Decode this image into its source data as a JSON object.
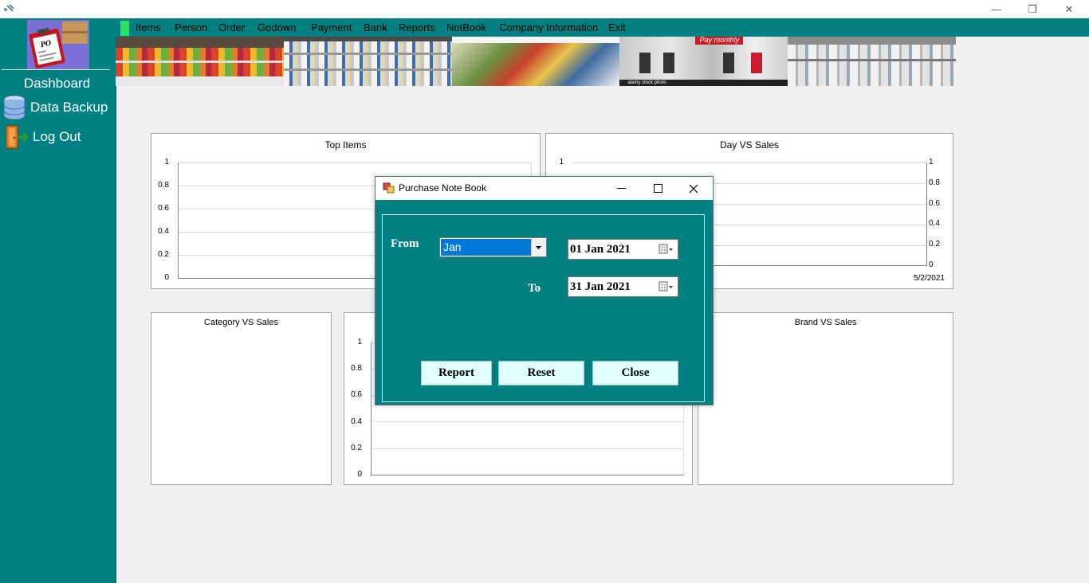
{
  "window": {
    "minimize_glyph": "—",
    "restore_glyph": "❐",
    "close_glyph": "✕"
  },
  "sidebar": {
    "logo_text": "PO",
    "dashboard_label": "Dashboard",
    "backup_label": "Data Backup",
    "logout_label": "Log Out"
  },
  "menu": {
    "items": [
      "Items",
      "Person",
      "Order",
      "Godown",
      "Payment",
      "Bank",
      "Reports",
      "NotBook",
      "Company Information",
      "Exit"
    ]
  },
  "banner": {
    "caption": "Pay monthly",
    "watermark": "alamy stock photo"
  },
  "panels": {
    "top_items": {
      "title": "Top Items"
    },
    "day_vs_sales": {
      "title": "Day VS Sales",
      "date_label": "5/2/2021"
    },
    "category_vs_sales": {
      "title": "Category VS Sales"
    },
    "brand_vs_sales": {
      "title": "Brand VS Sales"
    }
  },
  "chart_data": [
    {
      "type": "bar",
      "title": "Top Items",
      "categories": [],
      "values": [],
      "ylim": [
        0,
        1
      ],
      "yticks": [
        "1",
        "0.8",
        "0.6",
        "0.4",
        "0.2",
        "0"
      ]
    },
    {
      "type": "line",
      "title": "Day VS Sales",
      "x": [
        "5/2/2021"
      ],
      "values": [],
      "ylim": [
        0,
        1
      ],
      "yticks": [
        "1",
        "0.8",
        "0.6",
        "0.4",
        "0.2",
        "0"
      ]
    },
    {
      "type": "bar",
      "title": "Category VS Sales",
      "values": []
    },
    {
      "type": "bar",
      "title": "",
      "values": [],
      "ylim": [
        0,
        1
      ],
      "yticks": [
        "1",
        "0.8",
        "0.6",
        "0.4",
        "0.2",
        "0"
      ]
    },
    {
      "type": "bar",
      "title": "Brand VS Sales",
      "values": []
    }
  ],
  "dialog": {
    "title": "Purchase Note Book",
    "from_label": "From",
    "to_label": "To",
    "month_selected": "Jan",
    "from_date": "01  Jan  2021",
    "to_date": "31  Jan  2021",
    "report_button": "Report",
    "reset_button": "Reset",
    "close_button": "Close"
  },
  "colors": {
    "teal": "#008080",
    "button_bg": "#e0ffff",
    "select_highlight": "#0078d7",
    "menu_marker": "#25e35c"
  }
}
